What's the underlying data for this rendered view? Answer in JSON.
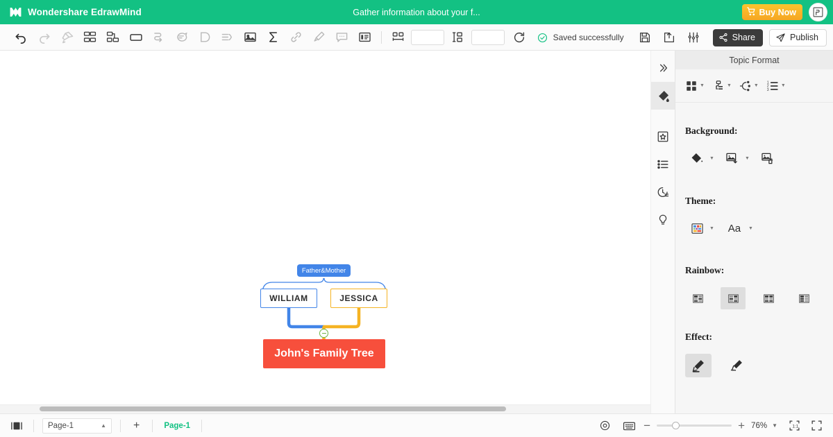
{
  "titlebar": {
    "app_name": "Wondershare EdrawMind",
    "document_title": "Gather information about your f...",
    "buy_now_label": "Buy Now",
    "logo_icon": "edrawmind-logo-icon",
    "cart_icon": "cart-icon",
    "avatar_icon": "user-avatar-icon",
    "background_color": "#13c183",
    "buy_now_color": "#f5a623"
  },
  "toolbar": {
    "items": [
      {
        "name": "undo-icon",
        "enabled": true
      },
      {
        "name": "redo-icon",
        "enabled": false
      },
      {
        "name": "format-painter-icon",
        "enabled": false
      },
      {
        "name": "subtopic-icon",
        "enabled": true
      },
      {
        "name": "topic-after-icon",
        "enabled": true
      },
      {
        "name": "topic-icon",
        "enabled": true
      },
      {
        "name": "relationship-icon",
        "enabled": false
      },
      {
        "name": "comment-icon",
        "enabled": false
      },
      {
        "name": "boundary-icon",
        "enabled": false
      },
      {
        "name": "summary-icon",
        "enabled": false
      },
      {
        "name": "image-icon",
        "enabled": true
      },
      {
        "name": "formula-icon",
        "enabled": true
      },
      {
        "name": "hyperlink-icon",
        "enabled": false
      },
      {
        "name": "highlighter-icon",
        "enabled": false
      },
      {
        "name": "note-icon",
        "enabled": false
      },
      {
        "name": "outline-icon",
        "enabled": true
      }
    ],
    "width_input_value": "",
    "height_input_value": "",
    "width_icon": "width-icon",
    "height_icon": "height-icon",
    "reset_icon": "reset-icon",
    "saved_text": "Saved successfully",
    "saved_icon": "check-circle-icon",
    "save_icon": "save-icon",
    "export_icon": "export-icon",
    "settings_icon": "settings-sliders-icon",
    "share_label": "Share",
    "share_icon": "share-icon",
    "publish_label": "Publish",
    "publish_icon": "publish-paperplane-icon"
  },
  "canvas": {
    "mindmap": {
      "root": {
        "label": "John's Family Tree",
        "color": "#f74f3c",
        "text_color": "#ffffff"
      },
      "branch_label": {
        "label": "Father&Mother",
        "color": "#4285e8",
        "text_color": "#ffffff"
      },
      "children": [
        {
          "label": "WILLIAM",
          "border_color": "#4285e8",
          "text_color": "#2b2b2b"
        },
        {
          "label": "JESSICA",
          "border_color": "#f5b323",
          "text_color": "#2b2b2b"
        }
      ],
      "collapse_button": {
        "name": "collapse-toggle",
        "state": "expanded",
        "color": "#6cb544"
      }
    }
  },
  "rail": {
    "items": [
      {
        "name": "expand-panel-icon",
        "active": false
      },
      {
        "name": "style-paint-icon",
        "active": true
      },
      {
        "name": "clipart-icon",
        "active": false
      },
      {
        "name": "outline-list-icon",
        "active": false
      },
      {
        "name": "history-clock-icon",
        "active": false
      },
      {
        "name": "idea-bulb-icon",
        "active": false
      }
    ]
  },
  "panel": {
    "title": "Topic Format",
    "icon_row": [
      {
        "name": "layout-grid-icon"
      },
      {
        "name": "org-chart-icon"
      },
      {
        "name": "branch-structure-icon"
      },
      {
        "name": "numbered-list-icon"
      }
    ],
    "sections": [
      {
        "label": "Background:",
        "buttons": [
          {
            "name": "fill-color-icon",
            "dropdown": true,
            "selected": false
          },
          {
            "name": "insert-background-image-icon",
            "dropdown": true,
            "selected": false
          },
          {
            "name": "delete-background-image-icon",
            "dropdown": false,
            "selected": false
          }
        ]
      },
      {
        "label": "Theme:",
        "buttons": [
          {
            "name": "theme-swatch-icon",
            "dropdown": true,
            "selected": false
          },
          {
            "name": "theme-font-icon",
            "dropdown": true,
            "selected": false,
            "text": "Aa"
          }
        ]
      },
      {
        "label": "Rainbow:",
        "buttons": [
          {
            "name": "rainbow-style-1",
            "selected": false
          },
          {
            "name": "rainbow-style-2",
            "selected": true
          },
          {
            "name": "rainbow-style-3",
            "selected": false
          },
          {
            "name": "rainbow-style-4",
            "selected": false
          }
        ]
      },
      {
        "label": "Effect:",
        "buttons": [
          {
            "name": "effect-solid-pen-icon",
            "selected": true
          },
          {
            "name": "effect-sketch-pen-icon",
            "selected": false
          }
        ]
      }
    ]
  },
  "statusbar": {
    "view_icon": "view-mode-icon",
    "page_select_value": "Page-1",
    "page_select_caret": "chevron-up-icon",
    "add_page_label": "+",
    "page_tab_label": "Page-1",
    "eye_icon": "preview-eye-icon",
    "keyboard_icon": "keyboard-shortcuts-icon",
    "zoom_out_label": "−",
    "zoom_in_label": "+",
    "zoom_level": "76%",
    "zoom_caret": "chevron-down-icon",
    "fit_icon": "fit-to-screen-icon",
    "fullscreen_icon": "fullscreen-icon",
    "accent_color": "#13c183"
  }
}
